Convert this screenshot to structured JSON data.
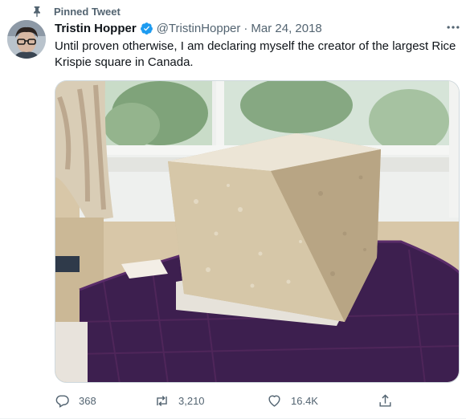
{
  "pinned": {
    "label": "Pinned Tweet"
  },
  "author": {
    "display_name": "Tristin Hopper",
    "handle": "@TristinHopper",
    "date": "Mar 24, 2018",
    "separator": "·"
  },
  "tweet": {
    "text": "Until proven otherwise, I am declaring myself the creator of the largest Rice Krispie square in Canada."
  },
  "stats": {
    "replies": "368",
    "retweets": "3,210",
    "likes": "16.4K"
  },
  "icons": {
    "pin": "pin-icon",
    "verified": "verified-badge-icon",
    "more": "more-icon",
    "reply": "reply-icon",
    "retweet": "retweet-icon",
    "like": "like-icon",
    "share": "share-icon"
  },
  "colors": {
    "text_primary": "#0f1419",
    "text_secondary": "#536471",
    "verified_blue": "#1d9bf0",
    "border": "#cfd9de"
  }
}
